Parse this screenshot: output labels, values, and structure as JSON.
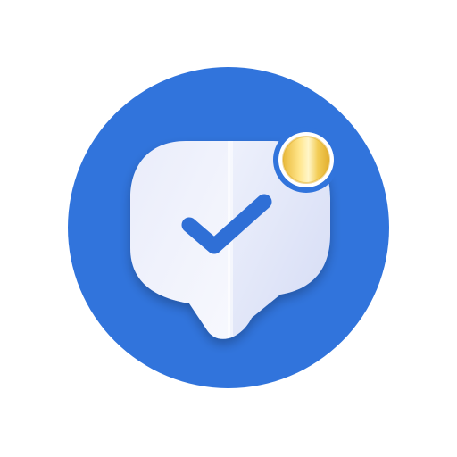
{
  "icon": {
    "name": "survey-rewards-app-icon",
    "glyphs": [
      "chat-bubble-icon",
      "checkmark-icon",
      "coin-icon"
    ]
  },
  "colors": {
    "background": "#ffffff",
    "circle": "#3174DC",
    "bubble_light": "#F7F8FD",
    "bubble_shade": "#D6DCF5",
    "check": "#2F6FD6",
    "coin_gold": "#F2C94C",
    "coin_highlight": "#FFF3B8"
  }
}
